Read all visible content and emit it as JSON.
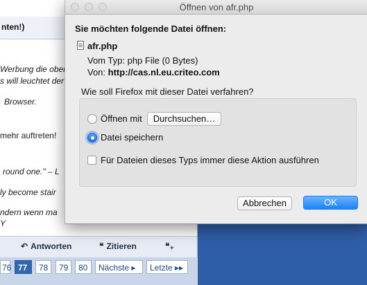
{
  "background_page": {
    "heading": "nten!)",
    "lines": [
      "Werbung die ober",
      "s will leuchtet der",
      "Browser.",
      "mehr auftreten!",
      "round one.\" – L",
      "ly become stair",
      "ndern wenn ma",
      "Y"
    ],
    "toolbar": {
      "reply": "Antworten",
      "quote": "Zitieren"
    },
    "pager": {
      "pages": [
        "76",
        "77",
        "78",
        "79",
        "80"
      ],
      "current": "77",
      "next": "Nächste ▸",
      "last": "Letzte ▸▸"
    }
  },
  "dialog": {
    "title": "Öffnen von afr.php",
    "heading": "Sie möchten folgende Datei öffnen:",
    "file_name": "afr.php",
    "type_label": "Vom Typ:",
    "type_value": "php File (0 Bytes)",
    "from_label": "Von:",
    "from_value": "http://cas.nl.eu.criteo.com",
    "question": "Wie soll Firefox mit dieser Datei verfahren?",
    "open_with_label": "Öffnen mit",
    "browse_button": "Durchsuchen…",
    "save_label": "Datei speichern",
    "save_selected": true,
    "always_label": "Für Dateien dieses Typs immer diese Aktion ausführen",
    "always_checked": false,
    "cancel_button": "Abbrechen",
    "ok_button": "OK"
  },
  "colors": {
    "accent": "#1a82fb",
    "page_blue": "#2f5ea8"
  }
}
